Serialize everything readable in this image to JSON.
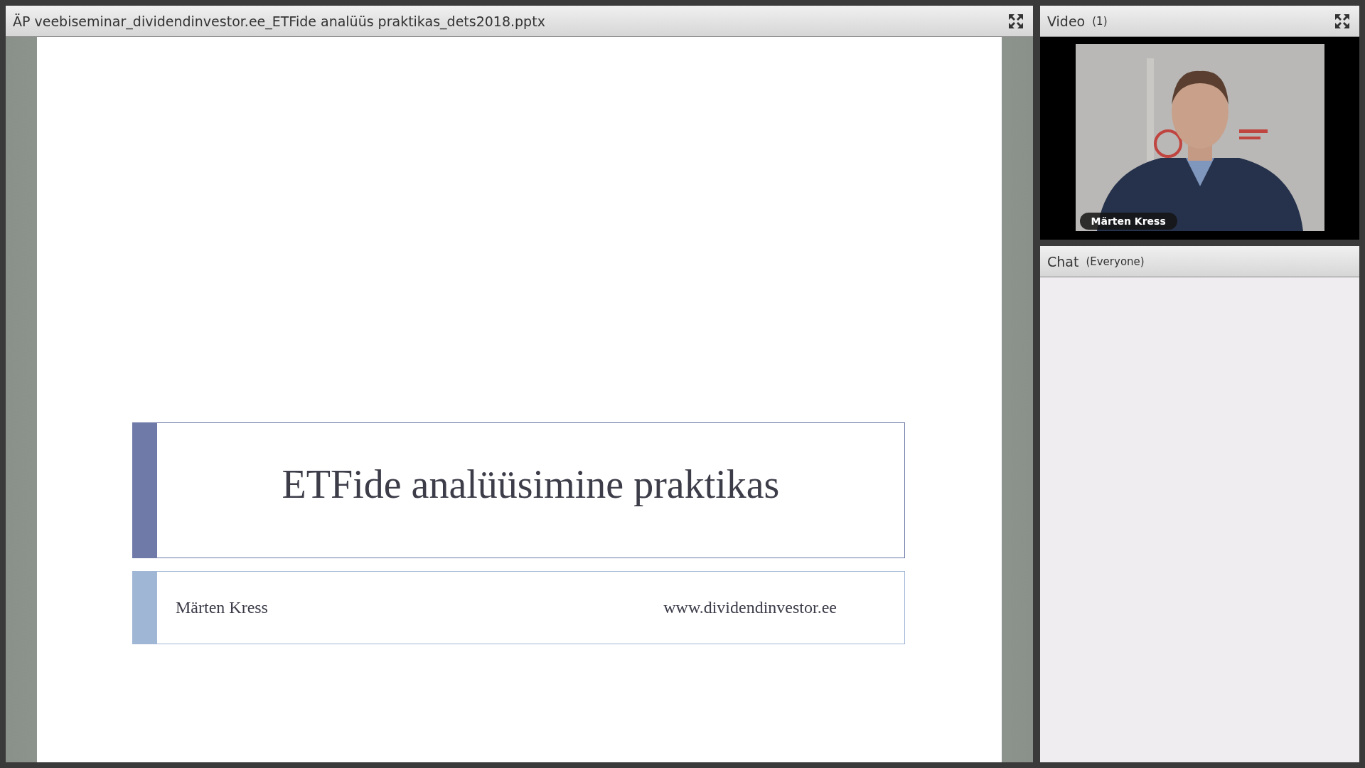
{
  "share_pod": {
    "title": "ÄP veebiseminar_dividendinvestor.ee_ETFide analüüs praktikas_dets2018.pptx"
  },
  "slide": {
    "title": "ETFide analüüsimine praktikas",
    "author": "Märten Kress",
    "website": "www.dividendinvestor.ee"
  },
  "video_pod": {
    "title": "Video",
    "count": "(1)",
    "video": {
      "kind": "picture",
      "participant_name": "Märten Kress"
    }
  },
  "chat_pod": {
    "title": "Chat",
    "audience": "(Everyone)"
  }
}
